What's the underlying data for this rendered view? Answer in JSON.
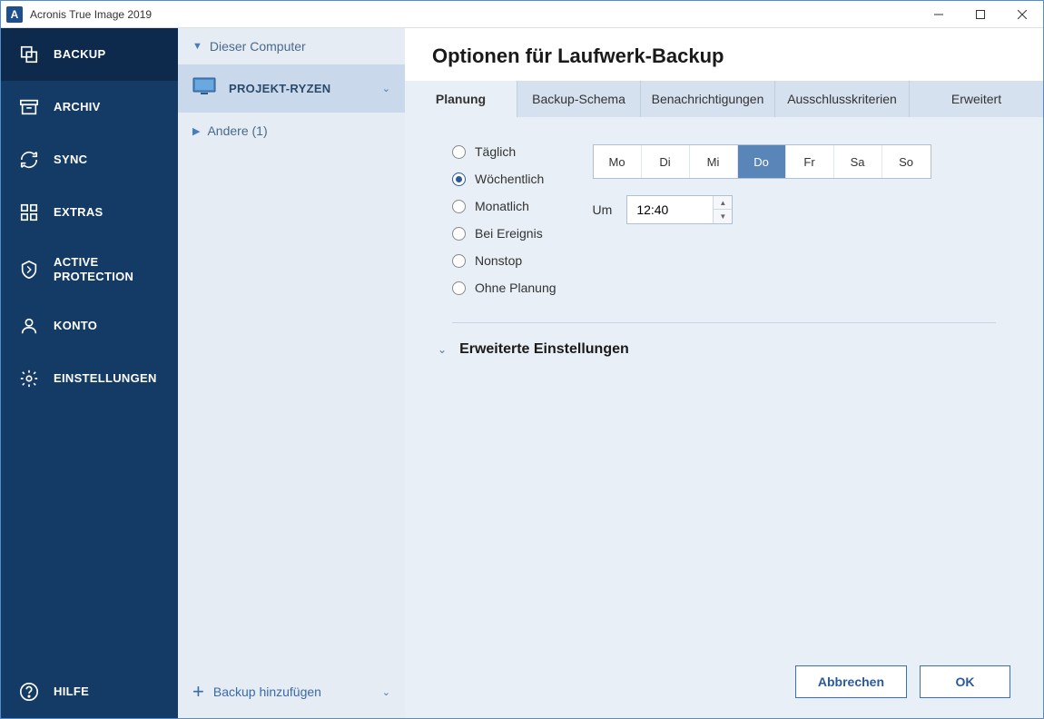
{
  "window": {
    "title": "Acronis True Image 2019"
  },
  "nav": {
    "items": [
      {
        "id": "backup",
        "label": "BACKUP"
      },
      {
        "id": "archiv",
        "label": "ARCHIV"
      },
      {
        "id": "sync",
        "label": "SYNC"
      },
      {
        "id": "extras",
        "label": "EXTRAS"
      },
      {
        "id": "active-protection",
        "label": "ACTIVE PROTECTION"
      },
      {
        "id": "konto",
        "label": "KONTO"
      },
      {
        "id": "einstellungen",
        "label": "EINSTELLUNGEN"
      }
    ],
    "help": "HILFE"
  },
  "list": {
    "header": "Dieser Computer",
    "selected": "PROJEKT-RYZEN",
    "other": "Andere (1)",
    "add": "Backup hinzufügen"
  },
  "main": {
    "title": "Optionen für Laufwerk-Backup",
    "tabs": [
      "Planung",
      "Backup-Schema",
      "Benachrichtigungen",
      "Ausschlusskriterien",
      "Erweitert"
    ],
    "schedule_options": [
      "Täglich",
      "Wöchentlich",
      "Monatlich",
      "Bei Ereignis",
      "Nonstop",
      "Ohne Planung"
    ],
    "selected_schedule": 1,
    "days": [
      "Mo",
      "Di",
      "Mi",
      "Do",
      "Fr",
      "Sa",
      "So"
    ],
    "selected_day": 3,
    "time_label": "Um",
    "time_value": "12:40",
    "advanced": "Erweiterte Einstellungen",
    "cancel": "Abbrechen",
    "ok": "OK"
  }
}
